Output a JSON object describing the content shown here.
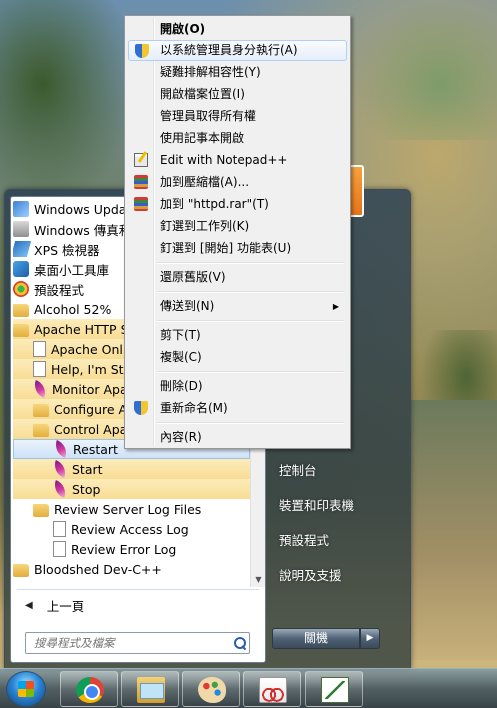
{
  "context_menu": {
    "items": [
      {
        "label": "開啟(O)"
      },
      {
        "label": "以系統管理員身分執行(A)",
        "icon": "uac-shield-icon"
      },
      {
        "label": "疑難排解相容性(Y)"
      },
      {
        "label": "開啟檔案位置(I)"
      },
      {
        "label": "管理員取得所有權"
      },
      {
        "label": "使用記事本開啟"
      },
      {
        "label": "Edit with Notepad++",
        "icon": "notepad-plus-plus-icon"
      },
      {
        "label": "加到壓縮檔(A)...",
        "icon": "winrar-icon"
      },
      {
        "label": "加到 \"httpd.rar\"(T)",
        "icon": "winrar-icon"
      },
      {
        "label": "釘選到工作列(K)"
      },
      {
        "label": "釘選到 [開始] 功能表(U)"
      },
      {
        "label": "還原舊版(V)"
      },
      {
        "label": "傳送到(N)",
        "submenu": true
      },
      {
        "label": "剪下(T)"
      },
      {
        "label": "複製(C)"
      },
      {
        "label": "刪除(D)"
      },
      {
        "label": "重新命名(M)",
        "icon": "uac-shield-icon"
      },
      {
        "label": "內容(R)"
      }
    ]
  },
  "start_menu": {
    "programs": [
      {
        "label": "Windows Update",
        "icon": "windows-update-icon"
      },
      {
        "label": "Windows 傳真和掃描",
        "icon": "fax-icon"
      },
      {
        "label": "XPS 檢視器",
        "icon": "xps-viewer-icon"
      },
      {
        "label": "桌面小工具庫",
        "icon": "gadget-icon"
      },
      {
        "label": "預設程式",
        "icon": "default-programs-icon"
      },
      {
        "label": "Alcohol 52%",
        "icon": "folder-icon"
      },
      {
        "label": "Apache HTTP Server",
        "icon": "folder-icon"
      },
      {
        "label": "Apache Online Documentation",
        "icon": "document-icon"
      },
      {
        "label": "Help, I'm Stuck!",
        "icon": "document-icon"
      },
      {
        "label": "Monitor Apache Servers",
        "icon": "apache-feather-icon"
      },
      {
        "label": "Configure Apache Server",
        "icon": "folder-icon"
      },
      {
        "label": "Control Apache Server",
        "icon": "folder-icon"
      },
      {
        "label": "Restart",
        "icon": "apache-feather-icon"
      },
      {
        "label": "Start",
        "icon": "apache-feather-icon"
      },
      {
        "label": "Stop",
        "icon": "apache-feather-icon"
      },
      {
        "label": "Review Server Log Files",
        "icon": "folder-icon"
      },
      {
        "label": "Review Access Log",
        "icon": "document-icon"
      },
      {
        "label": "Review Error Log",
        "icon": "document-icon"
      },
      {
        "label": "Bloodshed Dev-C++",
        "icon": "folder-icon"
      }
    ],
    "back_label": "上一頁",
    "search_placeholder": "搜尋程式及檔案",
    "right_items": [
      {
        "label": "控制台"
      },
      {
        "label": "裝置和印表機"
      },
      {
        "label": "預設程式"
      },
      {
        "label": "說明及支援"
      }
    ],
    "shutdown_label": "關機"
  },
  "taskbar": {
    "apps": [
      {
        "name": "chrome-icon"
      },
      {
        "name": "windows-explorer-icon"
      },
      {
        "name": "paint-icon"
      },
      {
        "name": "snipping-tool-icon"
      },
      {
        "name": "notepad-plus-plus-icon"
      }
    ]
  }
}
